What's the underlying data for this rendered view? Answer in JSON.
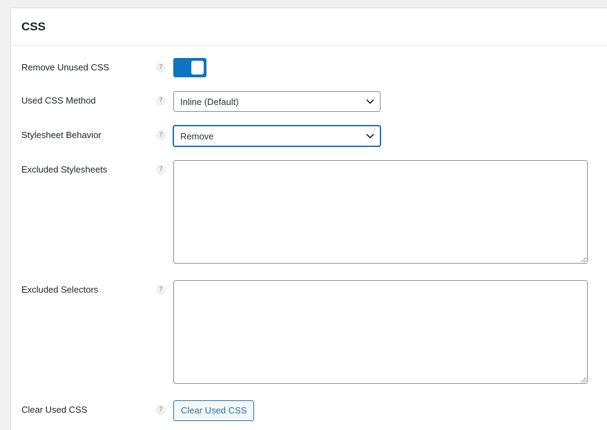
{
  "section": {
    "title": "CSS"
  },
  "help_icon_glyph": "?",
  "rows": {
    "remove_unused": {
      "label": "Remove Unused CSS",
      "toggle_on": true
    },
    "method": {
      "label": "Used CSS Method",
      "selected": "Inline (Default)"
    },
    "stylesheet_behavior": {
      "label": "Stylesheet Behavior",
      "selected": "Remove"
    },
    "excluded_stylesheets": {
      "label": "Excluded Stylesheets",
      "value": ""
    },
    "excluded_selectors": {
      "label": "Excluded Selectors",
      "value": ""
    },
    "clear_used_css": {
      "label": "Clear Used CSS",
      "button_label": "Clear Used CSS"
    }
  },
  "colors": {
    "accent": "#0e74bf",
    "link": "#2271b1",
    "page_bg": "#f0f0f1"
  },
  "icons": {
    "help": "help-icon",
    "chevron": "chevron-down-icon",
    "grip": "resize-grip-icon"
  }
}
